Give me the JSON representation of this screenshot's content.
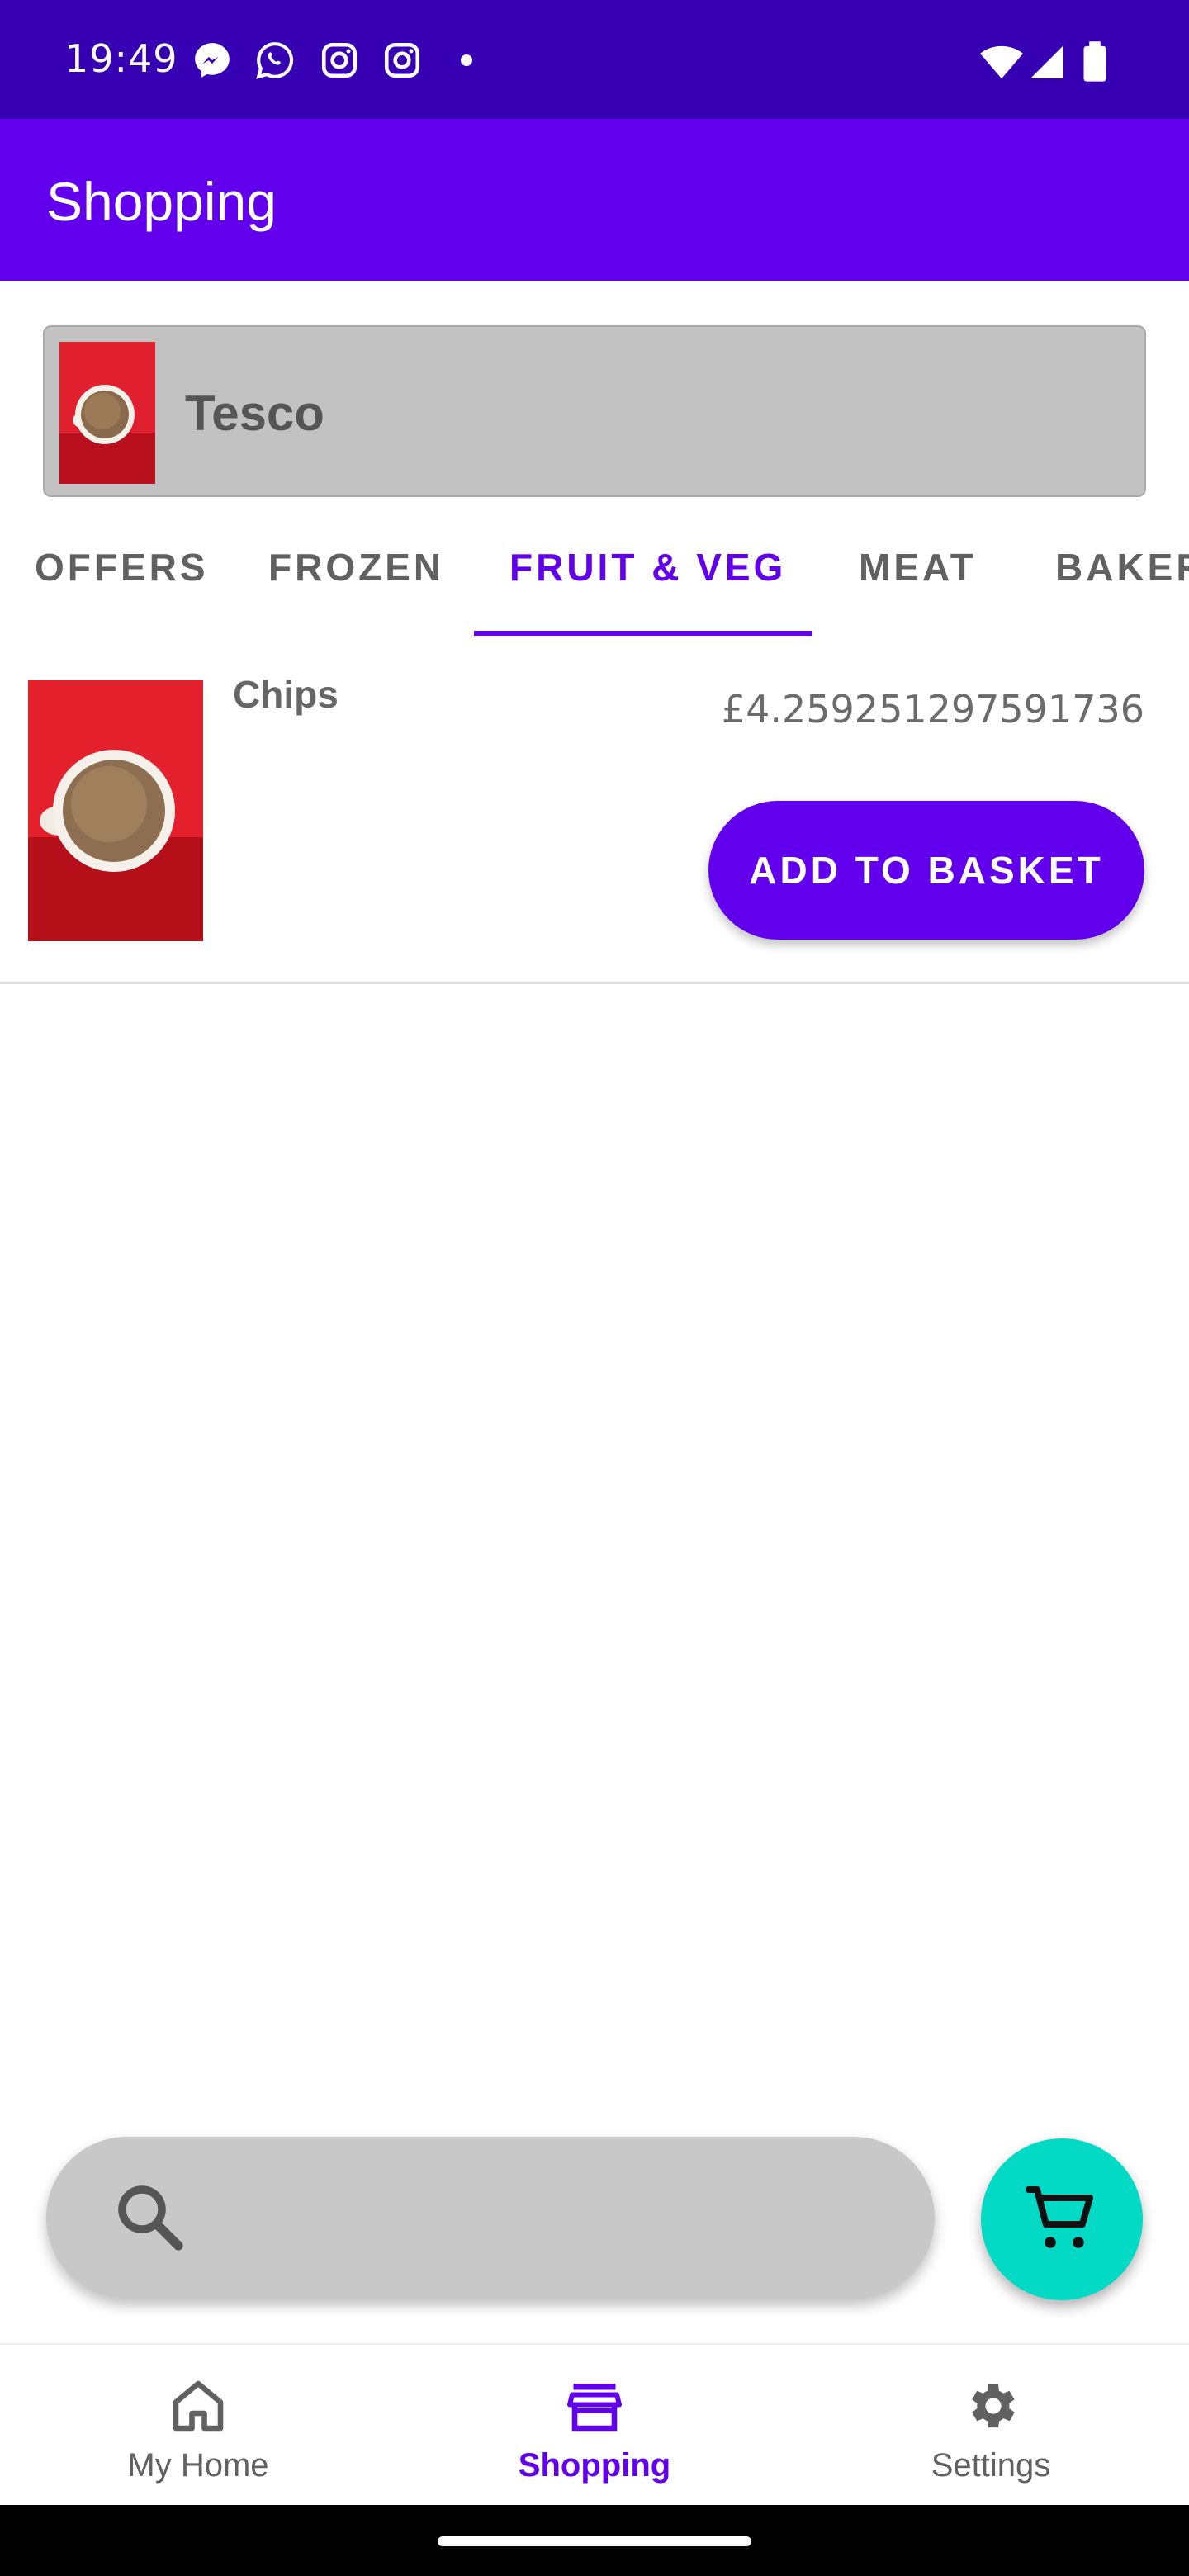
{
  "status_bar": {
    "time": "19:49",
    "notification_icons": [
      "messenger-icon",
      "whatsapp-icon",
      "instagram-icon",
      "instagram-icon"
    ],
    "system_icons": [
      "wifi-icon",
      "signal-icon",
      "battery-icon"
    ]
  },
  "app_bar": {
    "title": "Shopping"
  },
  "store": {
    "name": "Tesco",
    "image": "tea-cup-image"
  },
  "tabs": [
    {
      "label": "OFFERS",
      "active": false
    },
    {
      "label": "FROZEN",
      "active": false
    },
    {
      "label": "FRUIT & VEG",
      "active": true
    },
    {
      "label": "MEAT",
      "active": false
    },
    {
      "label": "BAKERY",
      "active": false
    }
  ],
  "products": [
    {
      "name": "Chips",
      "price": "£4.259251297591736",
      "image": "tea-cup-image",
      "button_label": "ADD TO BASKET"
    }
  ],
  "search": {
    "placeholder": "",
    "icon": "search-icon"
  },
  "fab": {
    "icon": "cart-icon"
  },
  "bottom_nav": [
    {
      "label": "My Home",
      "icon": "home-icon",
      "active": false
    },
    {
      "label": "Shopping",
      "icon": "store-icon",
      "active": true
    },
    {
      "label": "Settings",
      "icon": "gear-icon",
      "active": false
    }
  ],
  "colors": {
    "status_bar": "#3700b3",
    "primary": "#6200ee",
    "secondary": "#03dac5",
    "selector_bg": "#c2c2c2"
  }
}
